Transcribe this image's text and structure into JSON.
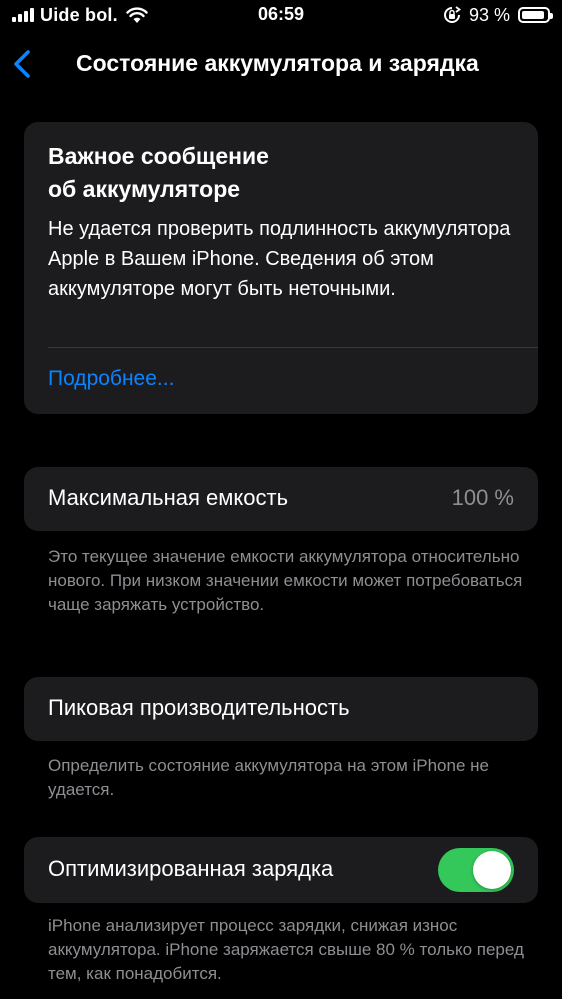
{
  "status_bar": {
    "carrier": "Uide bol.",
    "time": "06:59",
    "battery_percent": "93 %",
    "battery_level": 0.93
  },
  "nav": {
    "title": "Состояние аккумулятора и зарядка"
  },
  "important": {
    "title": "Важное сообщение\nоб аккумуляторе",
    "text": "Не удается проверить подлинность аккумулятора Apple в Вашем iPhone. Сведения об этом аккумуляторе могут быть неточными.",
    "link": "Подробнее..."
  },
  "max_capacity": {
    "label": "Максимальная емкость",
    "value": "100 %",
    "footnote": "Это текущее значение емкости аккумулятора относительно нового. При низком значении емкости может потребоваться чаще заряжать устройство."
  },
  "peak_performance": {
    "label": "Пиковая производительность",
    "footnote": "Определить состояние аккумулятора на этом iPhone не удается."
  },
  "optimized_charging": {
    "label": "Оптимизированная зарядка",
    "enabled": true,
    "footnote": "iPhone анализирует процесс зарядки, снижая износ аккумулятора. iPhone заряжается свыше 80 % только перед тем, как понадобится."
  },
  "colors": {
    "accent": "#0a84ff",
    "toggle_on": "#34c759",
    "card_bg": "#1c1c1e",
    "secondary_text": "#8e8e93"
  }
}
